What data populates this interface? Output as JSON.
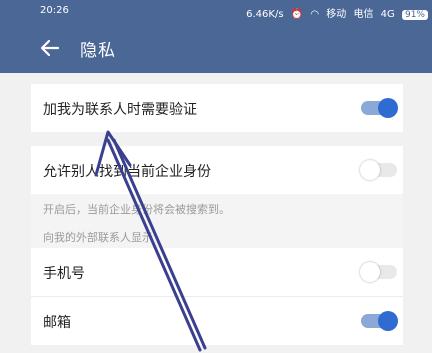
{
  "status_bar": {
    "time": "20:26",
    "speed": "6.46K/s",
    "carrier_1": "移动",
    "carrier_2": "电信",
    "network": "4G",
    "battery": "91%"
  },
  "header": {
    "title": "隐私",
    "back_icon": "arrow-left-icon"
  },
  "settings": {
    "verify_label": "加我为联系人时需要验证",
    "verify_on": true,
    "find_label": "允许别人找到当前企业身份",
    "find_on": false,
    "find_note": "开启后，当前企业身份将会被搜索到。",
    "section_header": "向我的外部联系人显示",
    "phone_label": "手机号",
    "phone_on": false,
    "email_label": "邮箱",
    "email_on": true
  },
  "colors": {
    "header_bg": "#4a6796",
    "toggle_on": "#2f6bd0",
    "arrow": "#3a3f8f"
  }
}
